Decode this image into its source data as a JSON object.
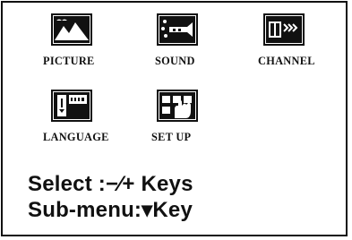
{
  "menu": {
    "items": [
      {
        "label": "PICTURE",
        "icon": "picture-icon"
      },
      {
        "label": "SOUND",
        "icon": "sound-icon"
      },
      {
        "label": "CHANNEL",
        "icon": "channel-icon"
      },
      {
        "label": "LANGUAGE",
        "icon": "language-icon"
      },
      {
        "label": "SET UP",
        "icon": "setup-icon"
      }
    ]
  },
  "help": {
    "select_line": "Select :−∕+ Keys",
    "submenu_line": "Sub-menu:▾Key"
  },
  "colors": {
    "foreground": "#111111",
    "background": "#ffffff"
  }
}
